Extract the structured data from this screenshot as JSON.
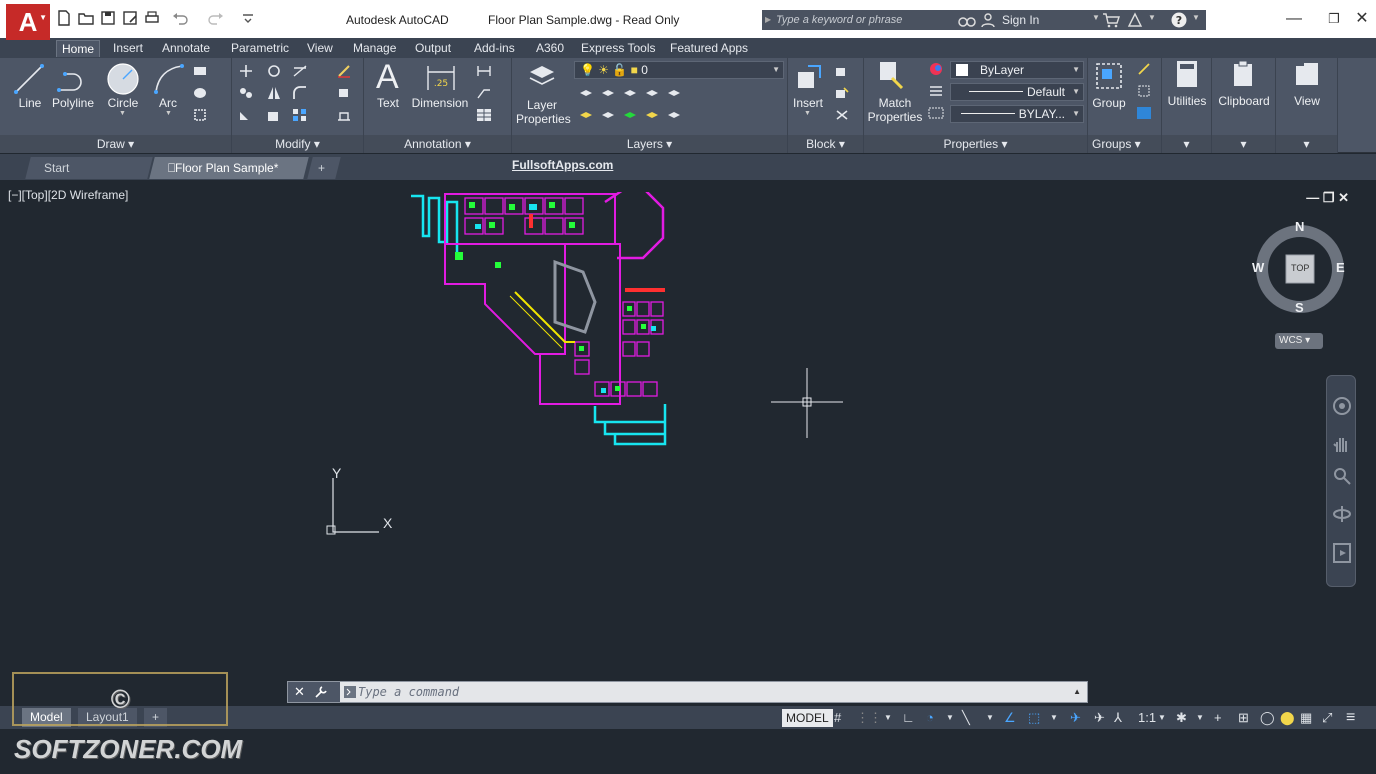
{
  "titlebar": {
    "app_letter": "A",
    "app_name": "Autodesk AutoCAD",
    "document": "Floor Plan Sample.dwg - Read Only",
    "search_placeholder": "Type a keyword or phrase",
    "sign_in": "Sign In"
  },
  "ribbon_tabs": [
    "Home",
    "Insert",
    "Annotate",
    "Parametric",
    "View",
    "Manage",
    "Output",
    "Add-ins",
    "A360",
    "Express Tools",
    "Featured Apps"
  ],
  "ribbon": {
    "draw": {
      "line": "Line",
      "polyline": "Polyline",
      "circle": "Circle",
      "arc": "Arc",
      "panel": "Draw ▾"
    },
    "modify": {
      "panel": "Modify ▾"
    },
    "annotation": {
      "text": "Text",
      "dimension": "Dimension",
      "panel": "Annotation ▾"
    },
    "layers": {
      "layer_properties_1": "Layer",
      "layer_properties_2": "Properties",
      "current_layer": "0",
      "panel": "Layers ▾"
    },
    "block": {
      "insert": "Insert",
      "panel": "Block ▾"
    },
    "properties": {
      "match_1": "Match",
      "match_2": "Properties",
      "color": "ByLayer",
      "linetype": "Default",
      "lineweight": "BYLAY...",
      "panel": "Properties ▾"
    },
    "groups": {
      "group": "Group",
      "panel": "Groups ▾"
    },
    "utilities": "Utilities",
    "clipboard": "Clipboard",
    "view": "View"
  },
  "filetabs": {
    "start": "Start",
    "current": "Floor Plan Sample*",
    "add": "+"
  },
  "watermark_fullsoft": "FullsoftApps.com",
  "viewport": {
    "label": "[−][Top][2D Wireframe]",
    "compass": {
      "n": "N",
      "s": "S",
      "e": "E",
      "w": "W",
      "top": "TOP",
      "wcs": "WCS"
    },
    "ucs_x": "X",
    "ucs_y": "Y"
  },
  "commandline": {
    "placeholder": "Type a command"
  },
  "statusbar": {
    "model_tab": "Model",
    "layout_tab": "Layout1",
    "add": "+",
    "model": "MODEL",
    "scale": "1:1"
  },
  "watermark_softzoner": "© SOFTZONER.COM",
  "colors": {
    "app_red": "#c62a28",
    "ribbon": "#4d5666",
    "canvas": "#212830",
    "cyan": "#17e5f0",
    "magenta": "#e21be2",
    "yellow": "#f2e600",
    "green": "#24ff3a"
  }
}
